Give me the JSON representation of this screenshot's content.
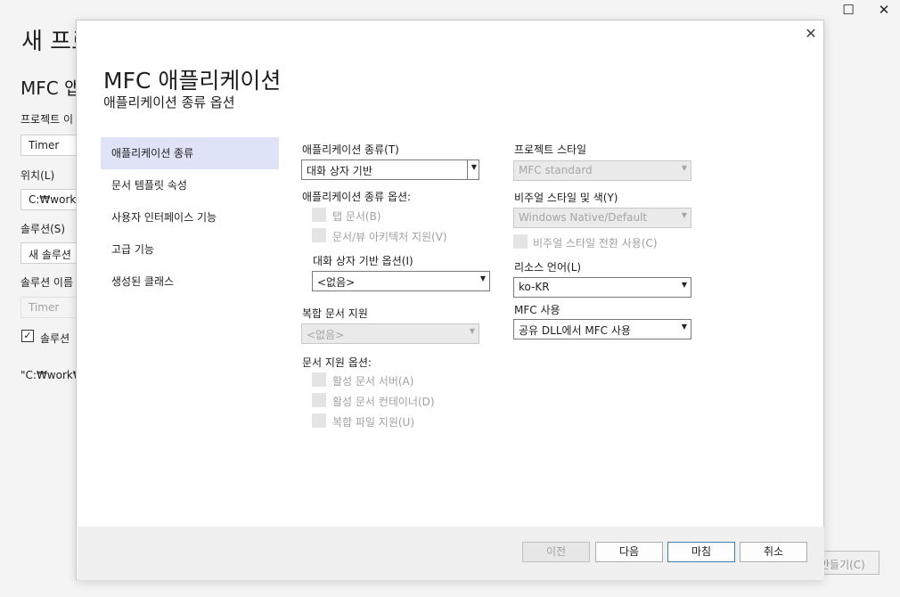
{
  "background": {
    "title": "새 프로",
    "subtitle": "MFC 앱",
    "project_name_label": "프로젝트 이",
    "project_name_value": "Timer",
    "location_label": "위치(L)",
    "location_value": "C:₩work",
    "solution_label": "솔루션(S)",
    "solution_value": "새 솔루션",
    "solution_name_label": "솔루션 이름",
    "solution_name_value": "Timer",
    "place_in_dir_label": "솔루션",
    "path_text": "\"C:₩work₩T",
    "create_button": "만들기(C)",
    "maximize_glyph": "☐",
    "close_glyph": "✕"
  },
  "dialog": {
    "close_glyph": "✕",
    "title": "MFC 애플리케이션",
    "subtitle": "애플리케이션 종류 옵션",
    "nav": [
      {
        "label": "애플리케이션 종류",
        "active": true
      },
      {
        "label": "문서 템플릿 속성",
        "active": false
      },
      {
        "label": "사용자 인터페이스 기능",
        "active": false
      },
      {
        "label": "고급 기능",
        "active": false
      },
      {
        "label": "생성된 클래스",
        "active": false
      }
    ],
    "col1": {
      "app_type_label": "애플리케이션 종류(T)",
      "app_type_value": "대화 상자 기반",
      "app_type_options_label": "애플리케이션 종류 옵션:",
      "tabbed_docs": "탭 문서(B)",
      "doc_view_support": "문서/뷰 아키텍처 지원(V)",
      "dialog_options_label": "대화 상자 기반 옵션(I)",
      "dialog_options_value": "<없음>",
      "compound_doc_label": "복합 문서 지원",
      "compound_doc_value": "<없음>",
      "doc_support_options_label": "문서 지원 옵션:",
      "active_doc_server": "활성 문서 서버(A)",
      "active_doc_container": "활성 문서 컨테이너(D)",
      "compound_file_support": "복합 파일 지원(U)"
    },
    "col2": {
      "project_style_label": "프로젝트 스타일",
      "project_style_value": "MFC standard",
      "visual_style_label": "비주얼 스타일 및 색(Y)",
      "visual_style_value": "Windows Native/Default",
      "enable_visual_style_switch": "비주얼 스타일 전환 사용(C)",
      "resource_lang_label": "리소스 언어(L)",
      "resource_lang_value": "ko-KR",
      "use_mfc_label": "MFC 사용",
      "use_mfc_value": "공유 DLL에서 MFC 사용"
    },
    "buttons": {
      "back": "이전",
      "next": "다음",
      "finish": "마침",
      "cancel": "취소"
    },
    "dropdown_glyph": "▼"
  }
}
